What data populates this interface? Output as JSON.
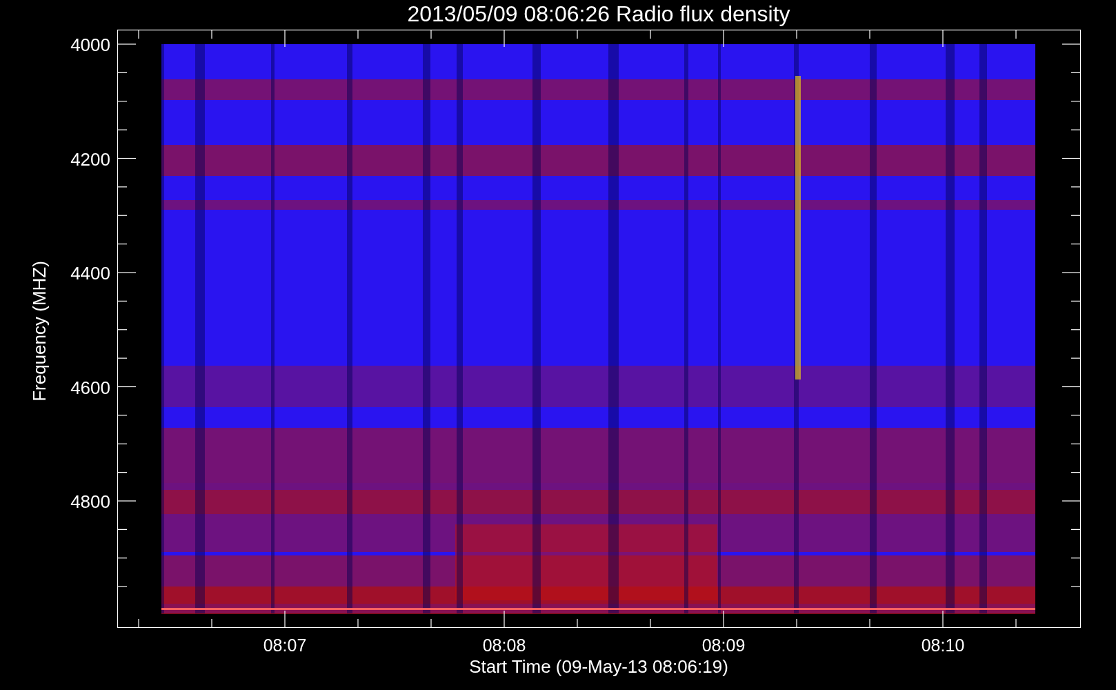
{
  "title": "2013/05/09 08:06:26 Radio flux density",
  "y_axis": {
    "label": "Frequency (MHZ)",
    "ticks": [
      "4000",
      "4200",
      "4400",
      "4600",
      "4800"
    ]
  },
  "x_axis": {
    "label": "Start Time (09-May-13 08:06:19)",
    "ticks": [
      "08:07",
      "08:08",
      "08:09",
      "08:10"
    ]
  }
}
